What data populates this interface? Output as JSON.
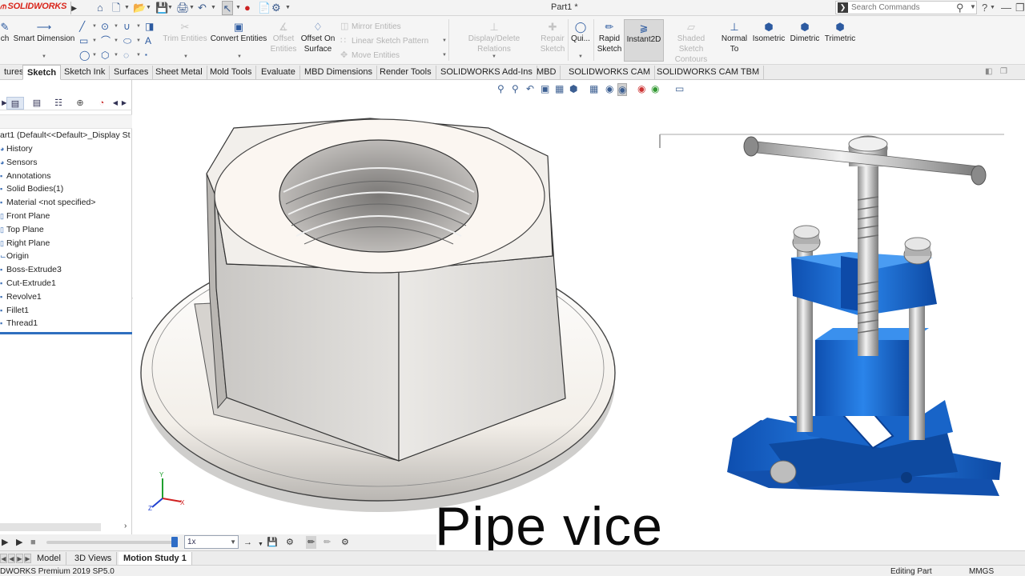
{
  "app": {
    "logo": "SOLIDWORKS",
    "document_title": "Part1 *"
  },
  "search": {
    "placeholder": "Search Commands"
  },
  "command_manager": {
    "smart_dimension": "Smart Dimension",
    "sketch_partial": "ch",
    "trim_entities": "Trim Entities",
    "convert_entities": "Convert Entities",
    "offset_entities_1": "Offset",
    "offset_entities_2": "Entities",
    "offset_on_surface_1": "Offset On",
    "offset_on_surface_2": "Surface",
    "mirror_entities": "Mirror Entities",
    "linear_sketch_pattern": "Linear Sketch Pattern",
    "move_entities": "Move Entities",
    "display_delete_relations": "Display/Delete Relations",
    "repair_sketch_1": "Repair",
    "repair_sketch_2": "Sketch",
    "quick_snaps": "Qui...",
    "rapid_sketch_1": "Rapid",
    "rapid_sketch_2": "Sketch",
    "instant2d": "Instant2D",
    "shaded_contours_1": "Shaded Sketch",
    "shaded_contours_2": "Contours",
    "normal_to_1": "Normal",
    "normal_to_2": "To",
    "isometric": "Isometric",
    "dimetric": "Dimetric",
    "trimetric": "Trimetric"
  },
  "tabs": [
    "tures",
    "Sketch",
    "Sketch Ink",
    "Surfaces",
    "Sheet Metal",
    "Mold Tools",
    "Evaluate",
    "MBD Dimensions",
    "Render Tools",
    "SOLIDWORKS Add-Ins",
    "MBD",
    "SOLIDWORKS CAM",
    "SOLIDWORKS CAM TBM"
  ],
  "feature_tree": {
    "root": "art1  (Default<<Default>_Display St",
    "items": [
      "History",
      "Sensors",
      "Annotations",
      "Solid Bodies(1)",
      "Material <not specified>",
      "Front Plane",
      "Top Plane",
      "Right Plane",
      "Origin",
      "Boss-Extrude3",
      "Cut-Extrude1",
      "Revolve1",
      "Fillet1",
      "Thread1"
    ]
  },
  "motion_bar": {
    "speed": "1x"
  },
  "bottom_tabs": [
    "Model",
    "3D Views",
    "Motion Study 1"
  ],
  "status": {
    "version": "DWORKS Premium 2019 SP5.0",
    "mode": "Editing Part",
    "units": "MMGS"
  },
  "caption": "Pipe vice",
  "colors": {
    "accent": "#2f6fbf",
    "vice_blue": "#1f6fd6",
    "logo_red": "#d9261c"
  }
}
